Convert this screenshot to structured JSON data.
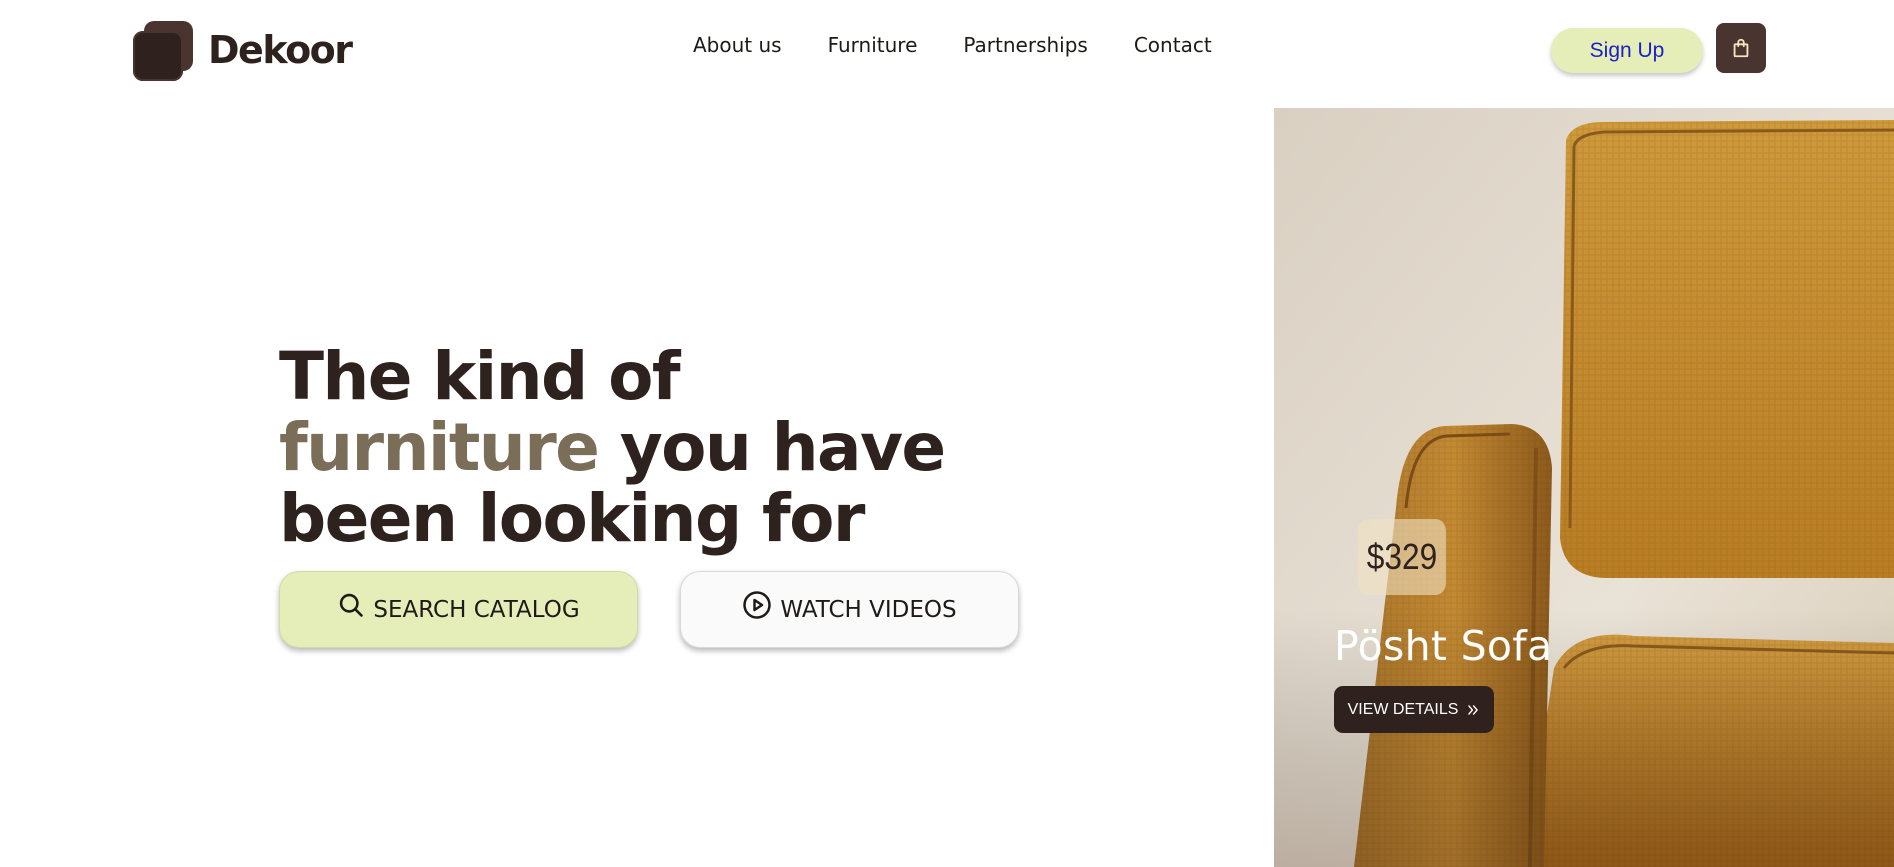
{
  "brand": {
    "name": "Dekoor"
  },
  "nav": {
    "items": [
      "About us",
      "Furniture",
      "Partnerships",
      "Contact"
    ]
  },
  "header": {
    "signup_label": "Sign Up",
    "cart_icon": "shopping-bag-icon"
  },
  "hero": {
    "headline_part1": "The kind of",
    "headline_accent": "furniture",
    "headline_part2": " you have been looking for",
    "search_button": "SEARCH CATALOG",
    "search_icon": "search-icon",
    "watch_button": "WATCH VIDEOS",
    "watch_icon": "play-circle-icon"
  },
  "product": {
    "price": "$329",
    "name": "Pösht Sofa",
    "details_button": "VIEW DETAILS",
    "details_icon": "chevrons-right-icon"
  },
  "colors": {
    "brand_dark": "#2f211e",
    "brand_brown": "#4a3430",
    "accent_text": "#7a6e58",
    "lime": "#e5eeb9",
    "signup_text": "#1b1fc4",
    "sofa_mustard": "#c4892c"
  }
}
